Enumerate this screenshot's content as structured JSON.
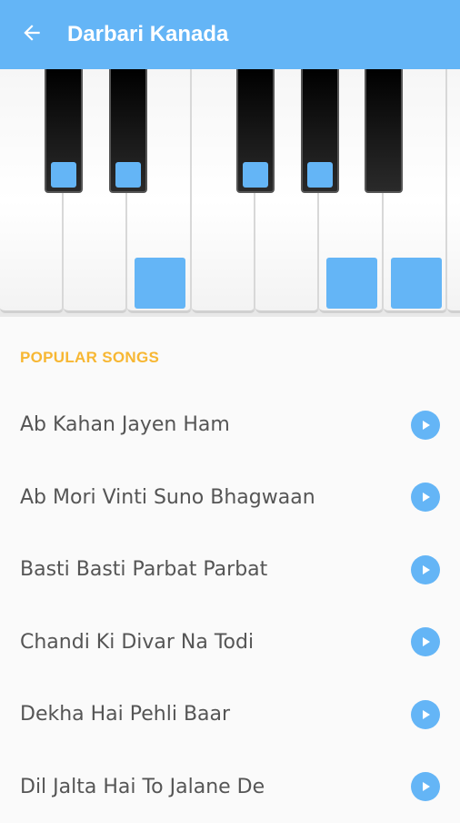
{
  "app_bar": {
    "title": "Darbari Kanada",
    "back_icon": "arrow-left-icon",
    "background": "#64b5f6"
  },
  "piano": {
    "white_key_count": 8,
    "black_key_count": 5,
    "highlight_color": "#64b5f6",
    "highlighted_black_keys": [
      1,
      2,
      3,
      4
    ],
    "highlighted_white_keys": [
      3,
      6,
      7
    ]
  },
  "songs": {
    "header": "POPULAR SONGS",
    "header_color": "#f7b733",
    "play_icon": "play-circle-icon",
    "items": [
      {
        "title": "Ab Kahan Jayen Ham"
      },
      {
        "title": "Ab Mori Vinti Suno Bhagwaan"
      },
      {
        "title": "Basti Basti Parbat Parbat"
      },
      {
        "title": "Chandi Ki Divar Na Todi"
      },
      {
        "title": "Dekha Hai Pehli Baar"
      },
      {
        "title": "Dil Jalta Hai To Jalane De"
      }
    ]
  }
}
